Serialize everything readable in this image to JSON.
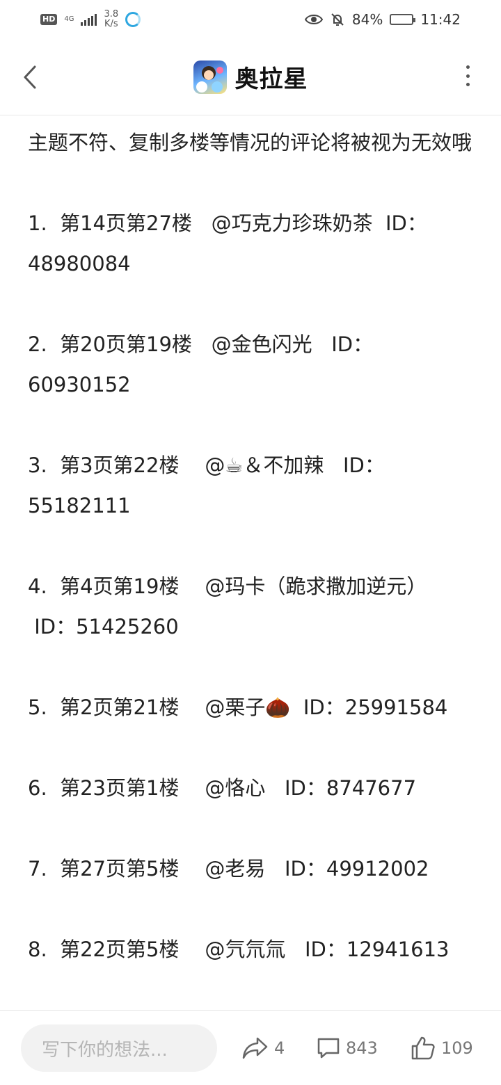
{
  "status_bar": {
    "hd": "HD",
    "network": "4G",
    "speed_value": "3.8",
    "speed_unit": "K/s",
    "battery_percent": "84%",
    "time": "11:42",
    "icons": [
      "hd-icon",
      "signal-icon",
      "app-notification-icon",
      "eye-icon",
      "mute-bell-icon",
      "battery-icon"
    ]
  },
  "header": {
    "title": "奥拉星",
    "back_icon": "chevron-left-icon",
    "more_icon": "vertical-ellipsis-icon"
  },
  "post": {
    "intro": "主题不符、复制多楼等情况的评论将被视为无效哦",
    "entries": [
      {
        "line1": "1.  第14页第27楼   @巧克力珍珠奶茶  ID：",
        "line2": "48980084"
      },
      {
        "line1": "2.  第20页第19楼   @金色闪光   ID：",
        "line2": "60930152"
      },
      {
        "line1": "3.  第3页第22楼    @☕＆不加辣   ID：",
        "line2": "55182111"
      },
      {
        "line1": "4.  第4页第19楼    @玛卡（跪求撒加逆元）",
        "line2": " ID：51425260"
      },
      {
        "line1": "5.  第2页第21楼    @栗子🌰  ID：25991584"
      },
      {
        "line1": "6.  第23页第1楼    @恪心   ID：8747677"
      },
      {
        "line1": "7.  第27页第5楼    @老易   ID：49912002"
      },
      {
        "line1": "8.  第22页第5楼    @氕氘氚   ID：12941613"
      }
    ]
  },
  "bottom_bar": {
    "comment_placeholder": "写下你的想法...",
    "share_count": "4",
    "comment_count": "843",
    "like_count": "109"
  }
}
